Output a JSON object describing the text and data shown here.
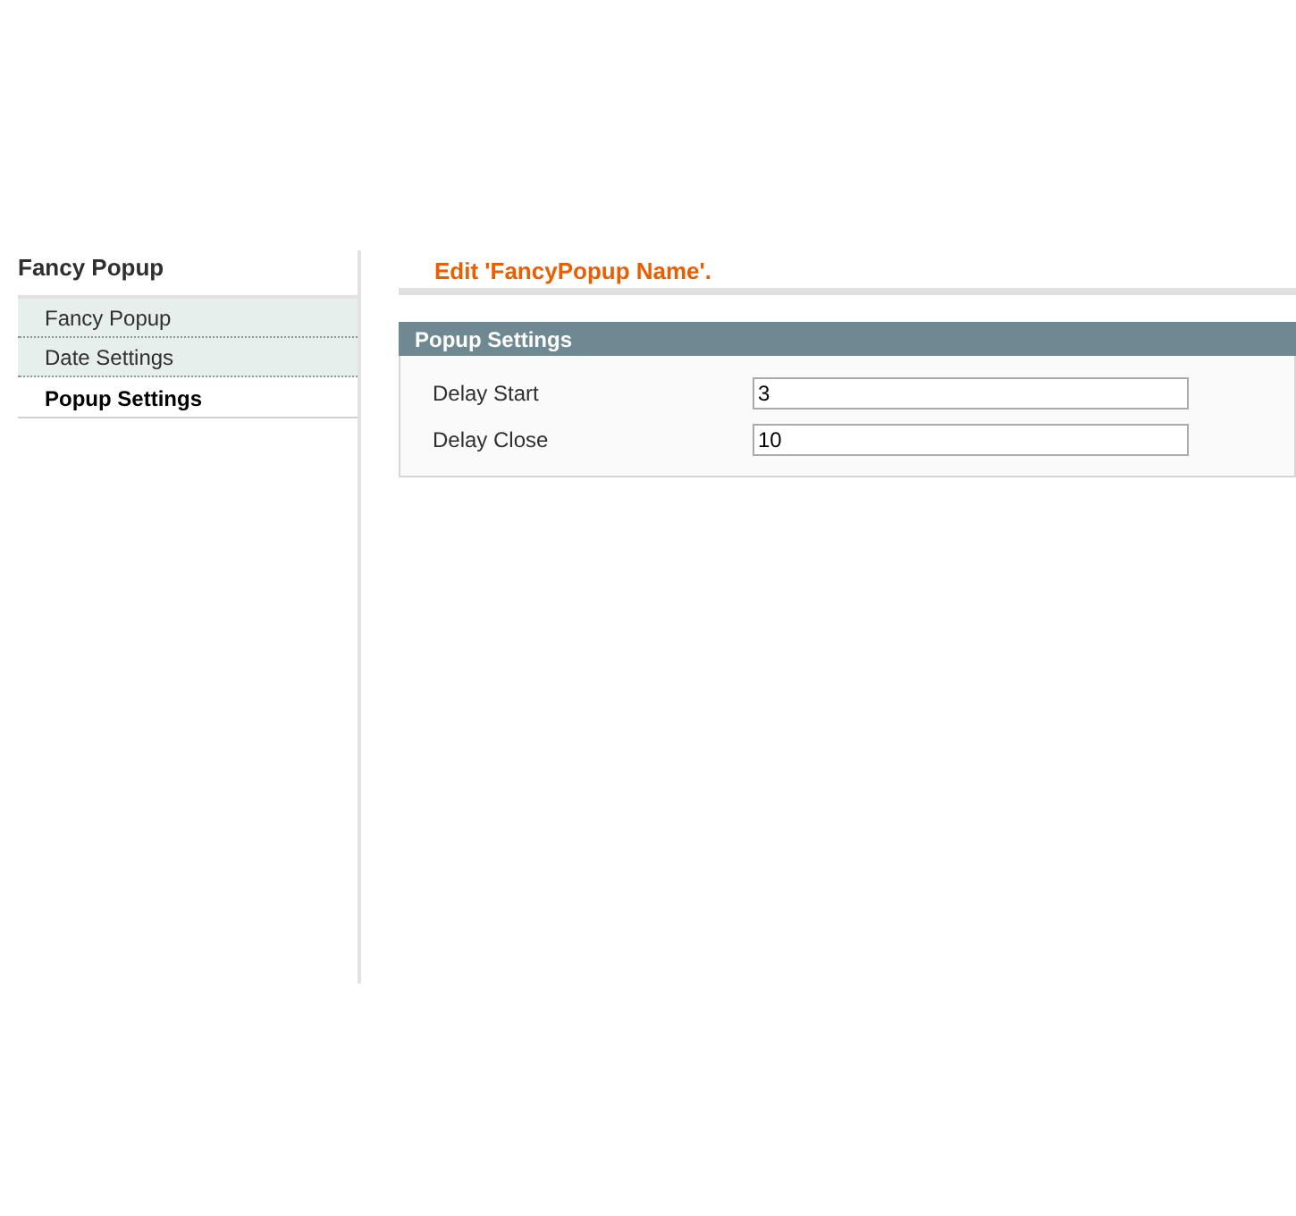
{
  "sidebar": {
    "title": "Fancy Popup",
    "tabs": [
      {
        "label": "Fancy Popup",
        "selected": false
      },
      {
        "label": "Date Settings",
        "selected": false
      },
      {
        "label": "Popup Settings",
        "selected": true
      }
    ]
  },
  "page_title": "Edit 'FancyPopup Name'.",
  "section": {
    "title": "Popup Settings",
    "fields": [
      {
        "label": "Delay Start",
        "value": "3"
      },
      {
        "label": "Delay Close",
        "value": "10"
      }
    ]
  }
}
